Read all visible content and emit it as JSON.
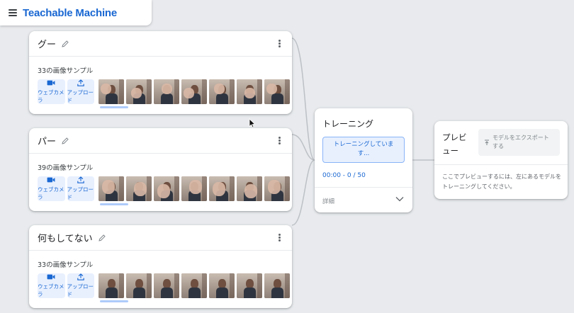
{
  "header": {
    "title": "Teachable Machine",
    "menu_icon": "hamburger-menu-icon"
  },
  "classes": [
    {
      "name": "グー",
      "sample_count": "33の画像サンプル",
      "webcam_label": "ウェブカメラ",
      "upload_label": "アップロード",
      "pose": "fist"
    },
    {
      "name": "パー",
      "sample_count": "39の画像サンプル",
      "webcam_label": "ウェブカメラ",
      "upload_label": "アップロード",
      "pose": "palm"
    },
    {
      "name": "何もしてない",
      "sample_count": "33の画像サンプル",
      "webcam_label": "ウェブカメラ",
      "upload_label": "アップロード",
      "pose": "none"
    }
  ],
  "training": {
    "title": "トレーニング",
    "button_label_line1": "トレーニングしていま",
    "button_label_line2": "す...",
    "progress": "00:00 - 0 / 50",
    "details_label": "詳細"
  },
  "preview": {
    "title": "プレビュー",
    "export_label": "モデルをエクスポートする",
    "message": "ここでプレビューするには、左にあるモデルをトレーニングしてください。"
  },
  "colors": {
    "accent": "#1967d2",
    "accent_light": "#e8f0fe",
    "background": "#e8eaed"
  }
}
